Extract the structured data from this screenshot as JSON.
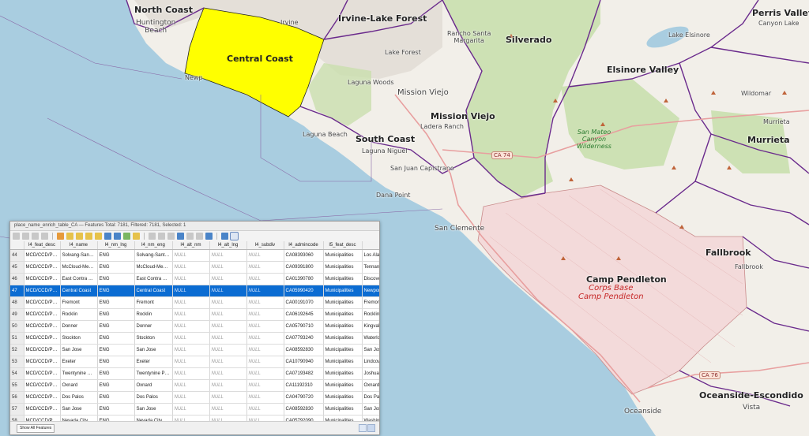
{
  "map": {
    "labels": {
      "north_coast": "North Coast",
      "huntington_beach": "Huntington\nBeach",
      "irvine_lake_forest": "Irvine-Lake Forest",
      "irvine": "Irvine",
      "lake_forest": "Lake Forest",
      "silverado": "Silverado",
      "perris_valley": "Perris Valley",
      "canyon_lake": "Canyon Lake",
      "lake_elsinore": "Lake Elsinore",
      "elsinore_valley": "Elsinore Valley",
      "wildomar": "Wildomar",
      "murrieta_city": "Murrieta",
      "murrieta_region": "Murrieta",
      "central_coast": "Central Coast",
      "newport": "Newp",
      "rancho": "Rancho Santa\nMargarita",
      "laguna_woods": "Laguna Woods",
      "mission_viejo_city": "Mission Viejo",
      "mission_viejo_region": "Mission Viejo",
      "ladera_ranch": "Ladera Ranch",
      "laguna_beach": "Laguna Beach",
      "south_coast": "South Coast",
      "laguna_niguel": "Laguna Niguel",
      "san_juan": "San Juan Capistrano",
      "dana_point": "Dana Point",
      "san_clemente": "San Clemente",
      "san_mateo_wilderness": "San Mateo\nCanyon\nWilderness",
      "camp_pendleton_region": "Camp Pendleton",
      "camp_pendleton_base": "Corps Base\nCamp Pendleton",
      "fallbrook_region": "Fallbrook",
      "fallbrook_city": "Fallbrook",
      "oceanside_escondido": "Oceanside-Escondido",
      "oceanside": "Oceanside",
      "vista": "Vista"
    },
    "shields": {
      "ca74": "CA 74",
      "ca76": "CA 76"
    },
    "colors": {
      "water": "#a9cde0",
      "land": "#f2efe9",
      "selected_fill": "#ffff00",
      "boundary": "#6a2a8c",
      "park": "#c9dfae",
      "base": "#f3dada"
    }
  },
  "attribute_table": {
    "title": "place_name_enrich_table_CA — Features Total: 7181, Filtered: 7181, Selected: 1",
    "columns": [
      "l4_feat_desc",
      "l4_name",
      "l4_nm_lng",
      "l4_nm_eng",
      "l4_alt_nm",
      "l4_alt_lng",
      "l4_subdiv",
      "l4_admincode",
      "l5_feat_desc",
      ""
    ],
    "rows": [
      {
        "n": "44",
        "c": [
          "MCD/CCD/Posit...",
          "Solvang-Santa ...",
          "ENG",
          "Solvang-Santa ...",
          "NULL",
          "NULL",
          "NULL",
          "CA08393060",
          "Municipalities",
          "Los Alam"
        ]
      },
      {
        "n": "45",
        "c": [
          "MCD/CCD/Posit...",
          "McCloud-Medi...",
          "ENG",
          "McCloud-Medi...",
          "NULL",
          "NULL",
          "NULL",
          "CA09391800",
          "Municipalities",
          "Tennant"
        ]
      },
      {
        "n": "46",
        "c": [
          "MCD/CCD/Posit...",
          "East Contra Cos...",
          "ENG",
          "East Contra Cos...",
          "NULL",
          "NULL",
          "NULL",
          "CA01390780",
          "Municipalities",
          "Discover"
        ]
      },
      {
        "n": "47",
        "c": [
          "MCD/CCD/Posit...",
          "Central Coast",
          "ENG",
          "Central Coast",
          "NULL",
          "NULL",
          "NULL",
          "CA05990420",
          "Municipalities",
          "Newport"
        ],
        "selected": true
      },
      {
        "n": "48",
        "c": [
          "MCD/CCD/Posit...",
          "Fremont",
          "ENG",
          "Fremont",
          "NULL",
          "NULL",
          "NULL",
          "CA00191070",
          "Municipalities",
          "Fremont"
        ]
      },
      {
        "n": "49",
        "c": [
          "MCD/CCD/Posit...",
          "Rocklin",
          "ENG",
          "Rocklin",
          "NULL",
          "NULL",
          "NULL",
          "CA06192645",
          "Municipalities",
          "Rocklin"
        ]
      },
      {
        "n": "50",
        "c": [
          "MCD/CCD/Posit...",
          "Donner",
          "ENG",
          "Donner",
          "NULL",
          "NULL",
          "NULL",
          "CA05790710",
          "Municipalities",
          "Kingvale"
        ]
      },
      {
        "n": "51",
        "c": [
          "MCD/CCD/Posit...",
          "Stockton",
          "ENG",
          "Stockton",
          "NULL",
          "NULL",
          "NULL",
          "CA07793240",
          "Municipalities",
          "Waterlo"
        ]
      },
      {
        "n": "52",
        "c": [
          "MCD/CCD/Posit...",
          "San Jose",
          "ENG",
          "San Jose",
          "NULL",
          "NULL",
          "NULL",
          "CA08592830",
          "Municipalities",
          "San Jos"
        ]
      },
      {
        "n": "53",
        "c": [
          "MCD/CCD/Posit...",
          "Exeter",
          "ENG",
          "Exeter",
          "NULL",
          "NULL",
          "NULL",
          "CA10790940",
          "Municipalities",
          "Lindcov"
        ]
      },
      {
        "n": "54",
        "c": [
          "MCD/CCD/Posit...",
          "Twentynine Pal...",
          "ENG",
          "Twentynine Pal...",
          "NULL",
          "NULL",
          "NULL",
          "CA07193482",
          "Municipalities",
          "Joshua"
        ]
      },
      {
        "n": "55",
        "c": [
          "MCD/CCD/Posit...",
          "Oxnard",
          "ENG",
          "Oxnard",
          "NULL",
          "NULL",
          "NULL",
          "CA11192310",
          "Municipalities",
          "Oxnard"
        ]
      },
      {
        "n": "56",
        "c": [
          "MCD/CCD/Posit...",
          "Dos Palos",
          "ENG",
          "Dos Palos",
          "NULL",
          "NULL",
          "NULL",
          "CA04790720",
          "Municipalities",
          "Dos Pal"
        ]
      },
      {
        "n": "57",
        "c": [
          "MCD/CCD/Posit...",
          "San Jose",
          "ENG",
          "San Jose",
          "NULL",
          "NULL",
          "NULL",
          "CA08592830",
          "Municipalities",
          "San Jos"
        ]
      },
      {
        "n": "58",
        "c": [
          "MCD/CCD/Posit...",
          "Nevada City",
          "ENG",
          "Nevada City",
          "NULL",
          "NULL",
          "NULL",
          "CA05792090",
          "Municipalities",
          "Washin"
        ]
      }
    ],
    "footer": {
      "show_features": "Show All Features"
    }
  }
}
